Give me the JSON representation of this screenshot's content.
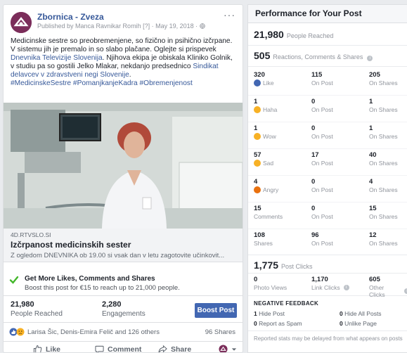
{
  "post": {
    "page_name": "Zbornica - Zveza",
    "meta": "Published by Manca Ravnikar Romih [?] · May 19, 2018 ·",
    "more_icon": "more-dots-icon",
    "text_part1": "Medicinske sestre so preobremenjene, so fizično in psihično izčrpane. V sistemu jih je premalo in so slabo plačane. Oglejte si prispevek ",
    "text_link1": "Dnevnika Televizije Slovenija",
    "text_part2": ". Njihova ekipa je obiskala Kliniko Golnik, v studiu pa so gostili Jelko Mlakar, nekdanjo predsednico ",
    "text_link2": "Sindikat delavcev v zdravstveni negi Slovenije",
    "text_part3": ".",
    "hashtags": "#MedicinskeSestre #PomanjkanjeKadra #Obremenjenost",
    "link": {
      "domain": "4D.RTVSLO.SI",
      "title": "Izčrpanost medicinskih sester",
      "description": "Z ogledom DNEVNIKA ob 19.00 si vsak dan v letu zagotovite učinkovit..."
    },
    "promo": {
      "title": "Get More Likes, Comments and Shares",
      "subtitle": "Boost this post for €15 to reach up to 21,000 people."
    },
    "stats": {
      "reached_value": "21,980",
      "reached_label": "People Reached",
      "engagements_value": "2,280",
      "engagements_label": "Engagements",
      "boost_label": "Boost Post"
    },
    "reactors": "Larisa Šic, Denis-Emira Felič and 126 others",
    "shares": "96 Shares",
    "actions": {
      "like": "Like",
      "comment": "Comment",
      "share": "Share"
    }
  },
  "performance": {
    "title": "Performance for Your Post",
    "reached_value": "21,980",
    "reached_label": "People Reached",
    "engagement_value": "505",
    "engagement_label": "Reactions, Comments & Shares",
    "rows": [
      {
        "total": "320",
        "total_label": "Like",
        "icon": "like-icon",
        "color": "#4267b2",
        "on_post": "115",
        "on_shares": "205"
      },
      {
        "total": "1",
        "total_label": "Haha",
        "icon": "haha-icon",
        "color": "#f7b125",
        "on_post": "0",
        "on_shares": "1"
      },
      {
        "total": "1",
        "total_label": "Wow",
        "icon": "wow-icon",
        "color": "#f7b125",
        "on_post": "0",
        "on_shares": "1"
      },
      {
        "total": "57",
        "total_label": "Sad",
        "icon": "sad-icon",
        "color": "#f7b125",
        "on_post": "17",
        "on_shares": "40"
      },
      {
        "total": "4",
        "total_label": "Angry",
        "icon": "angry-icon",
        "color": "#e9710f",
        "on_post": "0",
        "on_shares": "4"
      },
      {
        "total": "15",
        "total_label": "Comments",
        "icon": "",
        "color": "",
        "on_post": "0",
        "on_shares": "15"
      },
      {
        "total": "108",
        "total_label": "Shares",
        "icon": "",
        "color": "",
        "on_post": "96",
        "on_shares": "12"
      }
    ],
    "on_post_label": "On Post",
    "on_shares_label": "On Shares",
    "clicks_value": "1,775",
    "clicks_label": "Post Clicks",
    "clicks": [
      {
        "value": "0",
        "label": "Photo Views"
      },
      {
        "value": "1,170",
        "label": "Link Clicks"
      },
      {
        "value": "605",
        "label": "Other Clicks"
      }
    ],
    "negative_title": "NEGATIVE FEEDBACK",
    "negative": [
      {
        "value": "1",
        "label": "Hide Post"
      },
      {
        "value": "0",
        "label": "Hide All Posts"
      },
      {
        "value": "0",
        "label": "Report as Spam"
      },
      {
        "value": "0",
        "label": "Unlike Page"
      }
    ],
    "footnote": "Reported stats may be delayed from what appears on posts"
  }
}
